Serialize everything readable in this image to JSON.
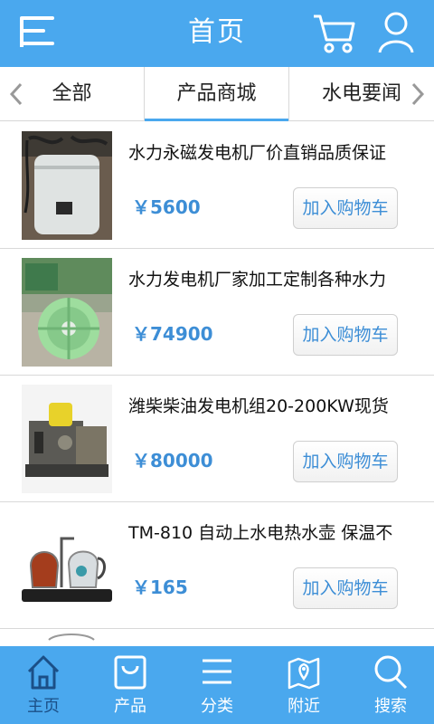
{
  "header": {
    "title": "首页"
  },
  "tabs": [
    {
      "label": "全部"
    },
    {
      "label": "产品商城"
    },
    {
      "label": "水电要闻"
    }
  ],
  "products": [
    {
      "name": "水力永磁发电机厂价直销品质保证",
      "price": "￥5600",
      "button": "加入购物车"
    },
    {
      "name": "水力发电机厂家加工定制各种水力",
      "price": "￥74900",
      "button": "加入购物车"
    },
    {
      "name": "潍柴柴油发电机组20-200KW现货",
      "price": "￥80000",
      "button": "加入购物车"
    },
    {
      "name": "TM-810 自动上水电热水壶 保温不",
      "price": "￥165",
      "button": "加入购物车"
    }
  ],
  "bottom_nav": [
    {
      "label": "主页",
      "icon": "home-icon",
      "active": true
    },
    {
      "label": "产品",
      "icon": "shopping-bag-icon"
    },
    {
      "label": "分类",
      "icon": "list-icon"
    },
    {
      "label": "附近",
      "icon": "map-pin-icon"
    },
    {
      "label": "搜索",
      "icon": "search-icon"
    }
  ],
  "colors": {
    "primary": "#4aa8ee",
    "price": "#3d8ed6",
    "active_nav": "#1b4f87"
  }
}
